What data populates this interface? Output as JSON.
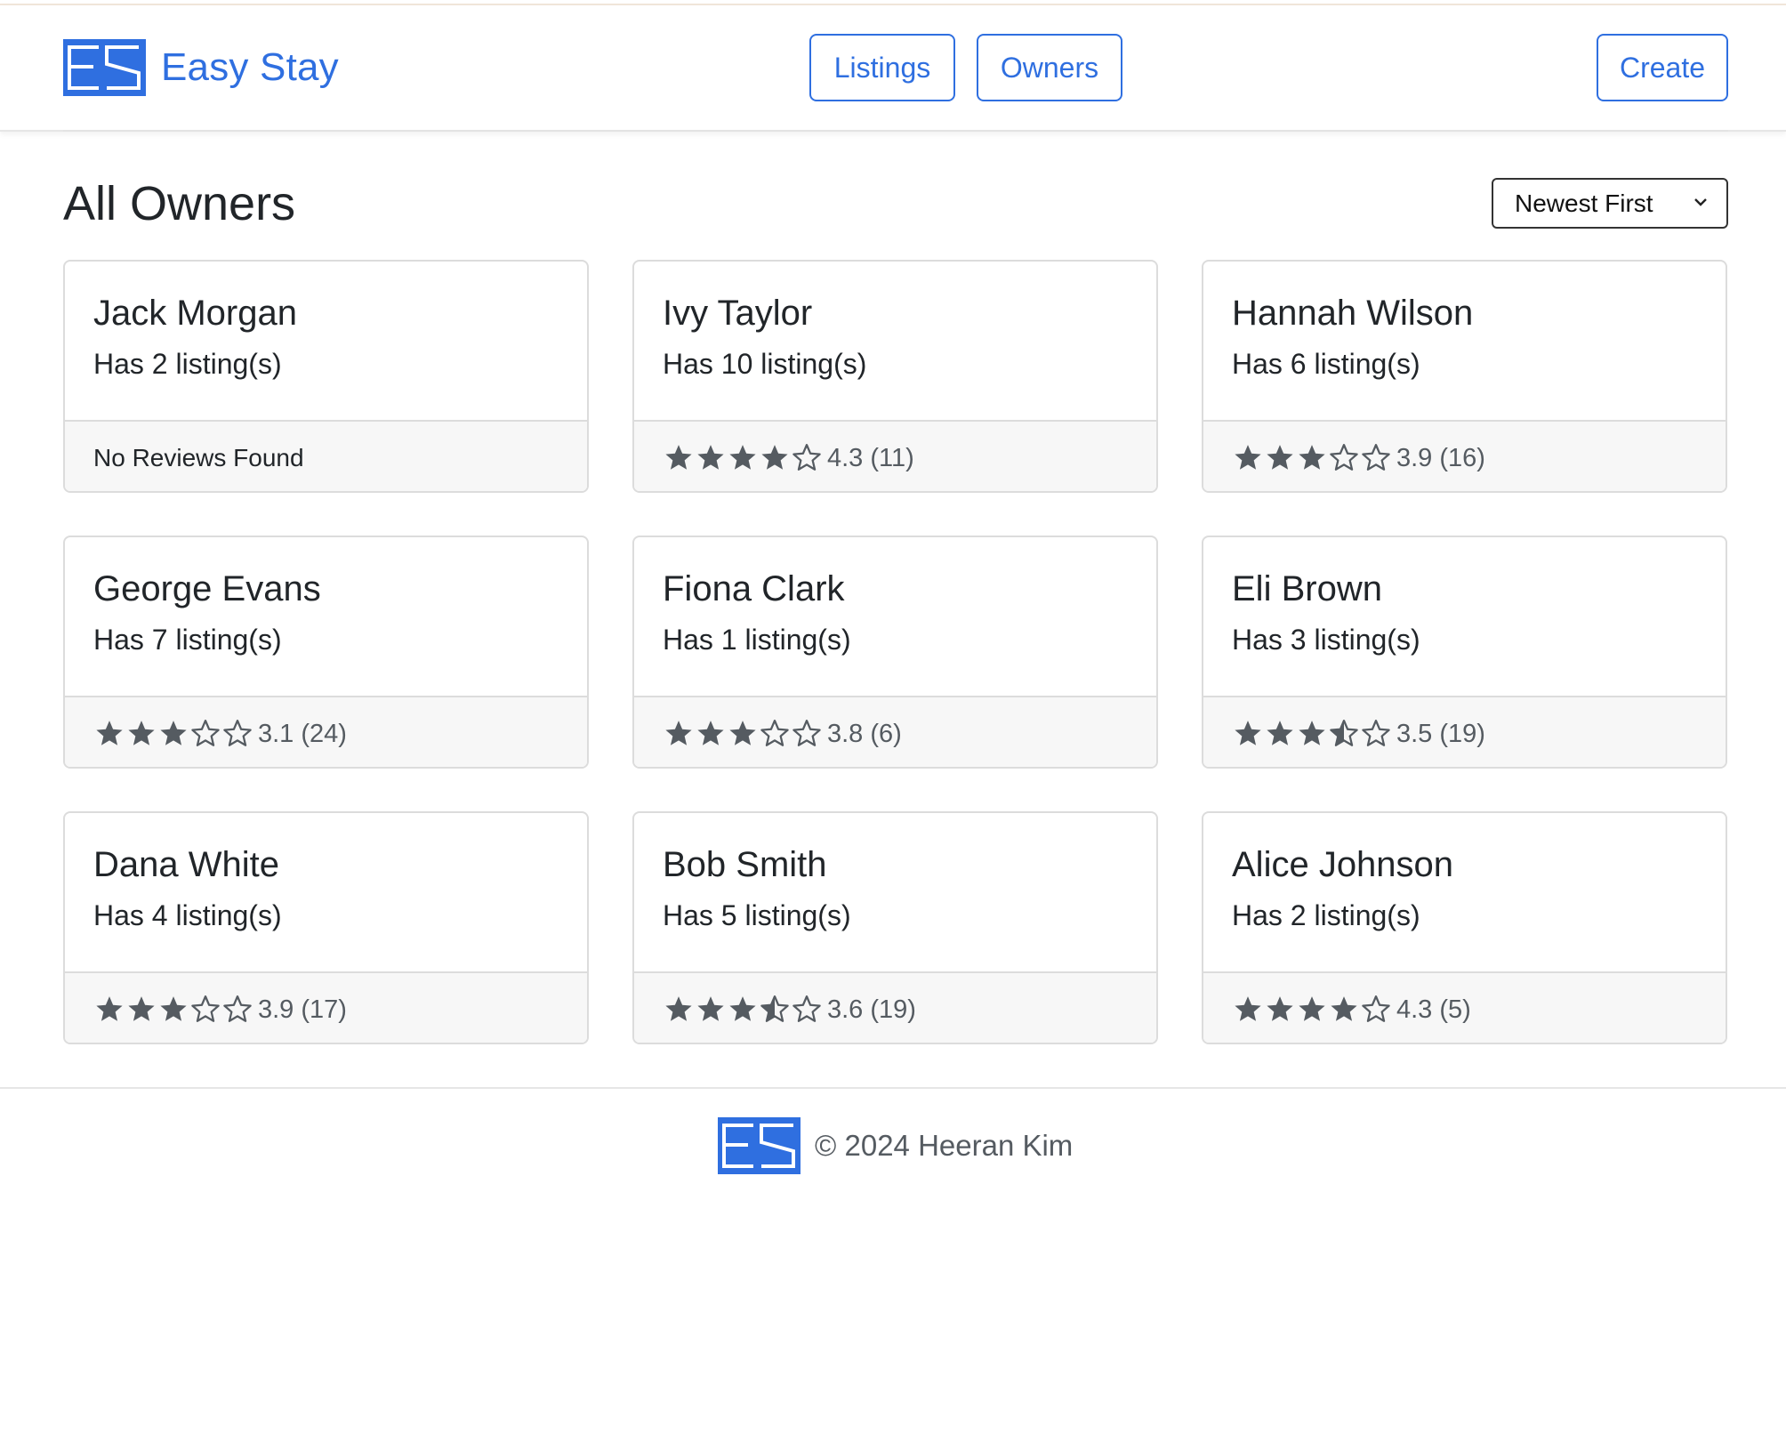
{
  "brand": {
    "name": "Easy Stay",
    "logo_icon": "es-logo-icon",
    "logo_color": "#2f6fe0"
  },
  "nav": {
    "listings": "Listings",
    "owners": "Owners",
    "create": "Create"
  },
  "page": {
    "title": "All Owners",
    "sort_selected": "Newest First"
  },
  "owners": [
    {
      "name": "Jack Morgan",
      "listings": "Has 2 listing(s)",
      "rating": null,
      "rating_text": "",
      "no_reviews": "No Reviews Found"
    },
    {
      "name": "Ivy Taylor",
      "listings": "Has 10 listing(s)",
      "rating": 4.3,
      "rating_text": "4.3 (11)"
    },
    {
      "name": "Hannah Wilson",
      "listings": "Has 6 listing(s)",
      "rating": 3.9,
      "rating_text": "3.9 (16)"
    },
    {
      "name": "George Evans",
      "listings": "Has 7 listing(s)",
      "rating": 3.1,
      "rating_text": "3.1 (24)"
    },
    {
      "name": "Fiona Clark",
      "listings": "Has 1 listing(s)",
      "rating": 3.8,
      "rating_text": "3.8 (6)"
    },
    {
      "name": "Eli Brown",
      "listings": "Has 3 listing(s)",
      "rating": 3.5,
      "rating_text": "3.5 (19)"
    },
    {
      "name": "Dana White",
      "listings": "Has 4 listing(s)",
      "rating": 3.9,
      "rating_text": "3.9 (17)"
    },
    {
      "name": "Bob Smith",
      "listings": "Has 5 listing(s)",
      "rating": 3.6,
      "rating_text": "3.6 (19)"
    },
    {
      "name": "Alice Johnson",
      "listings": "Has 2 listing(s)",
      "rating": 4.3,
      "rating_text": "4.3 (5)"
    }
  ],
  "footer": {
    "copyright": "© 2024 Heeran Kim"
  },
  "colors": {
    "accent": "#2f6fe0",
    "star": "#555b61"
  }
}
